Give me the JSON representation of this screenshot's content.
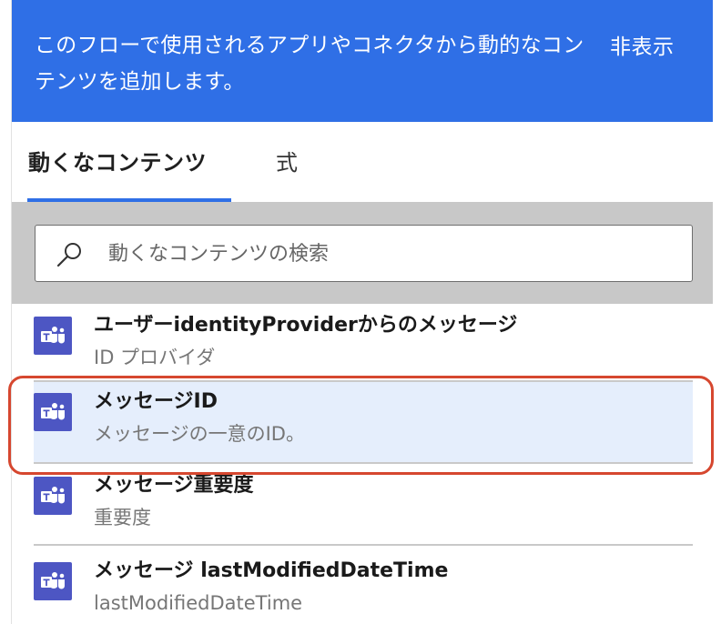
{
  "banner": {
    "text": "このフローで使用されるアプリやコネクタから動的なコンテンツを追加します。",
    "hide_label": "非表示"
  },
  "tabs": [
    {
      "label": "動くなコンテンツ",
      "active": true
    },
    {
      "label": "式",
      "active": false
    }
  ],
  "search": {
    "placeholder": "動くなコンテンツの検索",
    "value": ""
  },
  "items": [
    {
      "title": "ユーザーidentityProviderからのメッセージ",
      "subtitle": "ID プロバイダ",
      "icon": "teams-icon",
      "selected": false
    },
    {
      "title": "メッセージID",
      "subtitle": "メッセージの一意のID。",
      "icon": "teams-icon",
      "selected": true
    },
    {
      "title": "メッセージ重要度",
      "subtitle": "重要度",
      "icon": "teams-icon",
      "selected": false
    },
    {
      "title": "メッセージ lastModifiedDateTime",
      "subtitle": "lastModifiedDateTime",
      "icon": "teams-icon",
      "selected": false
    }
  ],
  "colors": {
    "accent": "#2f6fe6",
    "teams_icon": "#4d56c3",
    "selected_row": "#e5eefc",
    "highlight_outline": "#d6472f"
  }
}
